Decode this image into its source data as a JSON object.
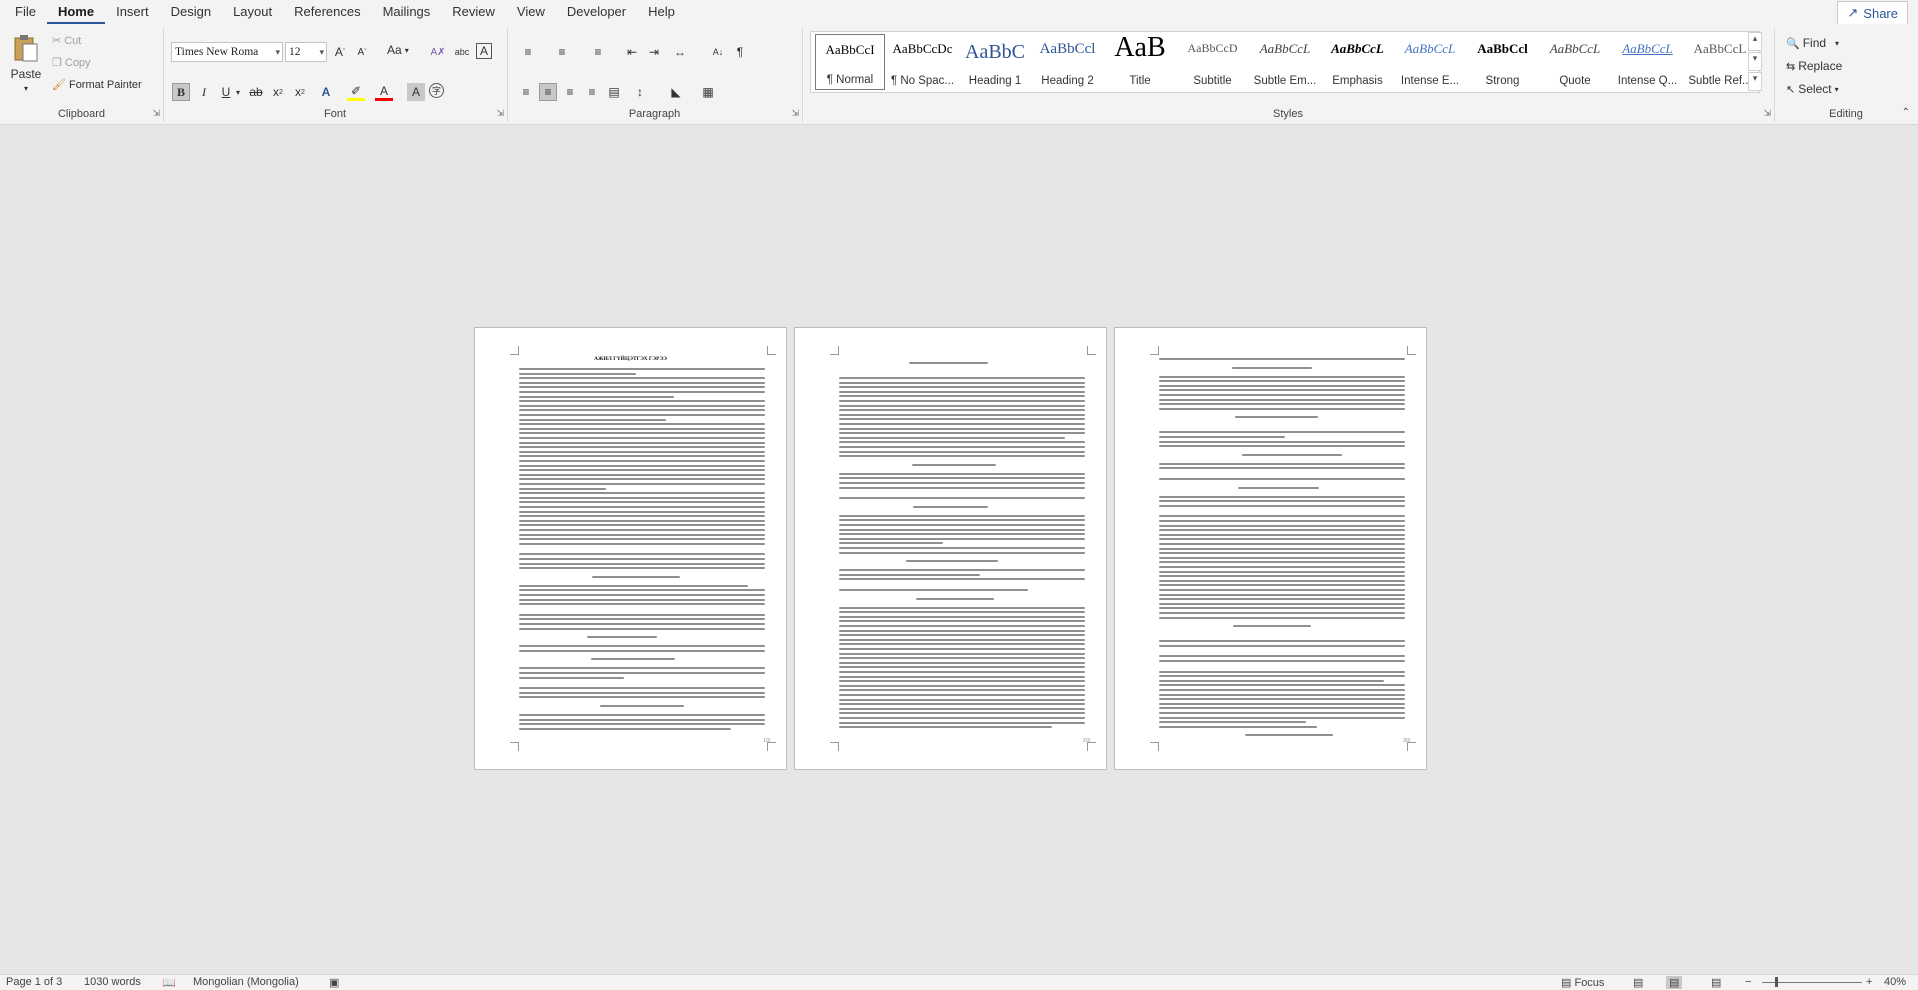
{
  "menu": {
    "tabs": [
      "File",
      "Home",
      "Insert",
      "Design",
      "Layout",
      "References",
      "Mailings",
      "Review",
      "View",
      "Developer",
      "Help"
    ],
    "active": "Home",
    "share_label": "Share"
  },
  "clipboard": {
    "paste": "Paste",
    "cut": "Cut",
    "copy": "Copy",
    "format_painter": "Format Painter",
    "label": "Clipboard"
  },
  "font": {
    "family": "Times New Roma",
    "size": "12",
    "label": "Font",
    "change_case": "Aa"
  },
  "paragraph": {
    "label": "Paragraph"
  },
  "styles": {
    "label": "Styles",
    "items": [
      {
        "sample": "AaBbCcI",
        "name": "¶ Normal",
        "color": "#000000"
      },
      {
        "sample": "AaBbCcDc",
        "name": "¶ No Spac...",
        "color": "#000000"
      },
      {
        "sample": "AaBbC",
        "name": "Heading 1",
        "color": "#2f5496"
      },
      {
        "sample": "AaBbCcl",
        "name": "Heading 2",
        "color": "#2f5496"
      },
      {
        "sample": "AaB",
        "name": "Title",
        "color": "#000000"
      },
      {
        "sample": "AaBbCcD",
        "name": "Subtitle",
        "color": "#595959"
      },
      {
        "sample": "AaBbCcL",
        "name": "Subtle Em...",
        "color": "#404040"
      },
      {
        "sample": "AaBbCcL",
        "name": "Emphasis",
        "color": "#000000"
      },
      {
        "sample": "AaBbCcL",
        "name": "Intense E...",
        "color": "#4472c4"
      },
      {
        "sample": "AaBbCcl",
        "name": "Strong",
        "color": "#000000"
      },
      {
        "sample": "AaBbCcL",
        "name": "Quote",
        "color": "#404040"
      },
      {
        "sample": "AaBbCcL",
        "name": "Intense Q...",
        "color": "#4472c4"
      },
      {
        "sample": "AaBbCcL",
        "name": "Subtle Ref...",
        "color": "#595959"
      }
    ]
  },
  "editing": {
    "find": "Find",
    "replace": "Replace",
    "select": "Select",
    "label": "Editing"
  },
  "pages": [
    {
      "title": "АЖИЛ ГҮЙЦЭТГЭХ ГЭРЭЭ",
      "number": "1/3"
    },
    {
      "number": "2/3"
    },
    {
      "number": "3/3"
    }
  ],
  "status": {
    "page": "Page 1 of 3",
    "words": "1030 words",
    "language": "Mongolian (Mongolia)",
    "focus": "Focus",
    "zoom": "40%"
  },
  "colors": {
    "accent": "#2b579a",
    "highlight": "#ffff00",
    "font_color": "#ff0000"
  }
}
